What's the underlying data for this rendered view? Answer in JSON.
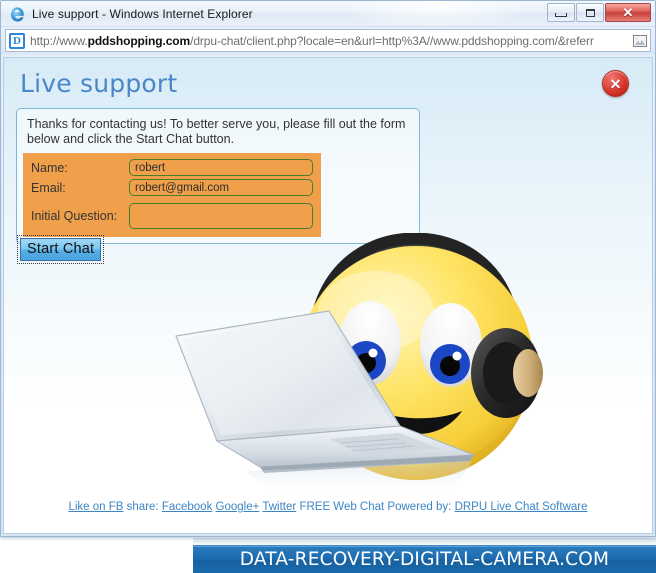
{
  "window": {
    "title": "Live support - Windows Internet Explorer",
    "app_icon": "internet-explorer-icon",
    "buttons": {
      "minimize": "–",
      "maximize": "□",
      "close": "✕"
    }
  },
  "address_bar": {
    "favicon_letter": "D",
    "url_prefix": "http://www.",
    "url_domain": "pddshopping.com",
    "url_rest": "/drpu-chat/client.php?locale=en&url=http%3A//www.pddshopping.com/&referr",
    "full_url": "http://www.pddshopping.com/drpu-chat/client.php?locale=en&url=http%3A//www.pddshopping.com/&referr",
    "right_icon": "page-compatibility-icon"
  },
  "page": {
    "title": "Live support",
    "close_button_label": "✕",
    "intro_text": "Thanks for contacting us! To better serve you, please fill out the form below and click the Start Chat button.",
    "form": {
      "fields": [
        {
          "label": "Name:",
          "value": "robert",
          "placeholder": ""
        },
        {
          "label": "Email:",
          "value": "robert@gmail.com",
          "placeholder": ""
        },
        {
          "label": "Initial Question:",
          "value": "",
          "placeholder": ""
        }
      ],
      "submit_label": "Start Chat"
    },
    "hero_image": "smiley-with-headset-and-laptop",
    "footer": {
      "like_label": "Like on FB",
      "share_label": "share:",
      "share_links": [
        "Facebook",
        "Google+",
        "Twitter"
      ],
      "powered_prefix": "FREE Web Chat Powered by:",
      "powered_link": "DRPU Live Chat Software"
    }
  },
  "site_banner": {
    "text": "DATA-RECOVERY-DIGITAL-CAMERA.COM"
  },
  "colors": {
    "accent_blue": "#3d86c6",
    "form_orange": "#f0a04a",
    "title_blue": "#4a86c8",
    "banner_blue": "#1f6cb0",
    "close_red": "#da362c",
    "input_border_green": "#4a7d2a"
  }
}
